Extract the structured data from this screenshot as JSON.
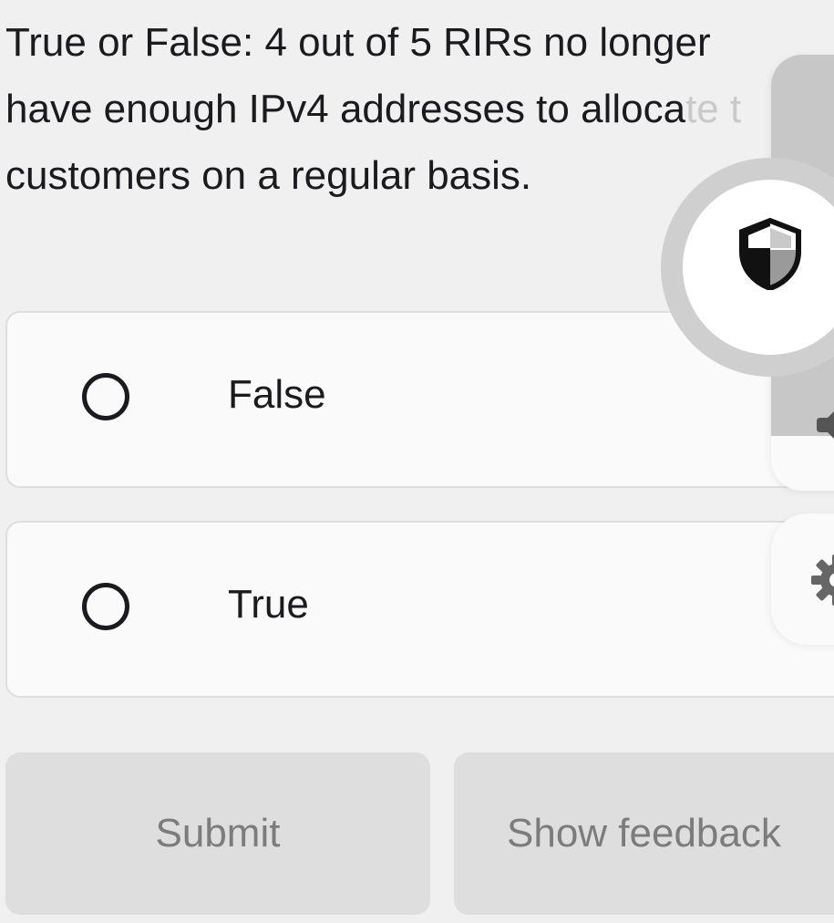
{
  "question": {
    "line1": "True or False: 4 out of 5 RIRs no longer",
    "line2_visible": "have enough IPv4 addresses to alloca",
    "line2_faded": "te t",
    "line3": "customers on a regular basis."
  },
  "options": [
    {
      "label": "False",
      "selected": false
    },
    {
      "label": "True",
      "selected": false
    }
  ],
  "buttons": {
    "submit": "Submit",
    "show_feedback": "Show feedback"
  },
  "icons": {
    "privacy": "shield-half-icon",
    "audio": "speaker-icon",
    "settings": "gear-icon"
  },
  "colors": {
    "text": "#1b1b1f",
    "background": "#f0f0f0",
    "button_bg": "#dedede",
    "button_text": "#7c7c7c",
    "option_bg": "#fafafa",
    "option_border": "#dedede"
  }
}
